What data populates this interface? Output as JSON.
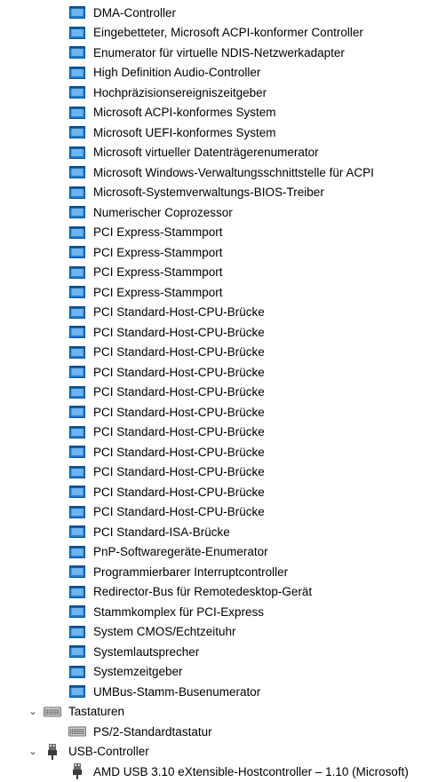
{
  "tree": {
    "system_devices": [
      "DMA-Controller",
      "Eingebetteter, Microsoft ACPI-konformer Controller",
      "Enumerator für virtuelle NDIS-Netzwerkadapter",
      "High Definition Audio-Controller",
      "Hochpräzisionsereigniszeitgeber",
      "Microsoft ACPI-konformes System",
      "Microsoft UEFI-konformes System",
      "Microsoft virtueller Datenträgerenumerator",
      "Microsoft Windows-Verwaltungsschnittstelle für ACPI",
      "Microsoft-Systemverwaltungs-BIOS-Treiber",
      "Numerischer Coprozessor",
      "PCI Express-Stammport",
      "PCI Express-Stammport",
      "PCI Express-Stammport",
      "PCI Express-Stammport",
      "PCI Standard-Host-CPU-Brücke",
      "PCI Standard-Host-CPU-Brücke",
      "PCI Standard-Host-CPU-Brücke",
      "PCI Standard-Host-CPU-Brücke",
      "PCI Standard-Host-CPU-Brücke",
      "PCI Standard-Host-CPU-Brücke",
      "PCI Standard-Host-CPU-Brücke",
      "PCI Standard-Host-CPU-Brücke",
      "PCI Standard-Host-CPU-Brücke",
      "PCI Standard-Host-CPU-Brücke",
      "PCI Standard-Host-CPU-Brücke",
      "PCI Standard-ISA-Brücke",
      "PnP-Softwaregeräte-Enumerator",
      "Programmierbarer Interruptcontroller",
      "Redirector-Bus für Remotedesktop-Gerät",
      "Stammkomplex für PCI-Express",
      "System CMOS/Echtzeituhr",
      "Systemlautsprecher",
      "Systemzeitgeber",
      "UMBus-Stamm-Busenumerator"
    ],
    "keyboards": {
      "label": "Tastaturen",
      "items": [
        "PS/2-Standardtastatur"
      ]
    },
    "usb": {
      "label": "USB-Controller",
      "items": [
        "AMD USB 3.10 eXtensible-Hostcontroller – 1.10 (Microsoft)"
      ]
    }
  },
  "icons": {
    "system_device": "system-device-icon",
    "keyboard": "keyboard-icon",
    "usb": "usb-plug-icon"
  },
  "colors": {
    "icon_blue": "#1e7fd2",
    "icon_dark": "#0b4f8f"
  }
}
